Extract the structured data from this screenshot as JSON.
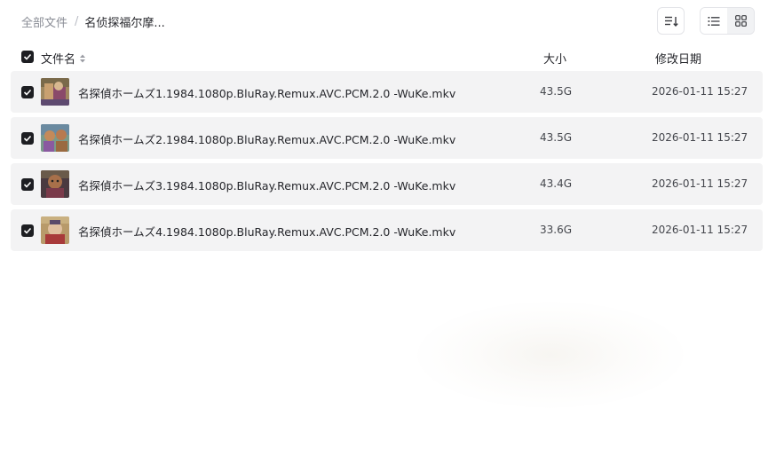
{
  "breadcrumb": {
    "root": "全部文件",
    "separator": "/",
    "current": "名侦探福尔摩..."
  },
  "toolbar": {
    "sort_icon": "sort-list-icon",
    "list_view_icon": "list-view-icon",
    "grid_view_icon": "grid-view-icon"
  },
  "header": {
    "name": "文件名",
    "size": "大小",
    "date": "修改日期"
  },
  "files": [
    {
      "name": "名探偵ホームズ1.1984.1080p.BluRay.Remux.AVC.PCM.2.0 -WuKe.mkv",
      "size": "43.5G",
      "date": "2026-01-11 15:27",
      "checked": true
    },
    {
      "name": "名探偵ホームズ2.1984.1080p.BluRay.Remux.AVC.PCM.2.0 -WuKe.mkv",
      "size": "43.5G",
      "date": "2026-01-11 15:27",
      "checked": true
    },
    {
      "name": "名探偵ホームズ3.1984.1080p.BluRay.Remux.AVC.PCM.2.0 -WuKe.mkv",
      "size": "43.4G",
      "date": "2026-01-11 15:27",
      "checked": true
    },
    {
      "name": "名探偵ホームズ4.1984.1080p.BluRay.Remux.AVC.PCM.2.0 -WuKe.mkv",
      "size": "33.6G",
      "date": "2026-01-11 15:27",
      "checked": true
    }
  ],
  "colors": {
    "row_bg": "#f3f3f4",
    "checkbox": "#1d1e22",
    "muted_text": "#8a8d96"
  }
}
